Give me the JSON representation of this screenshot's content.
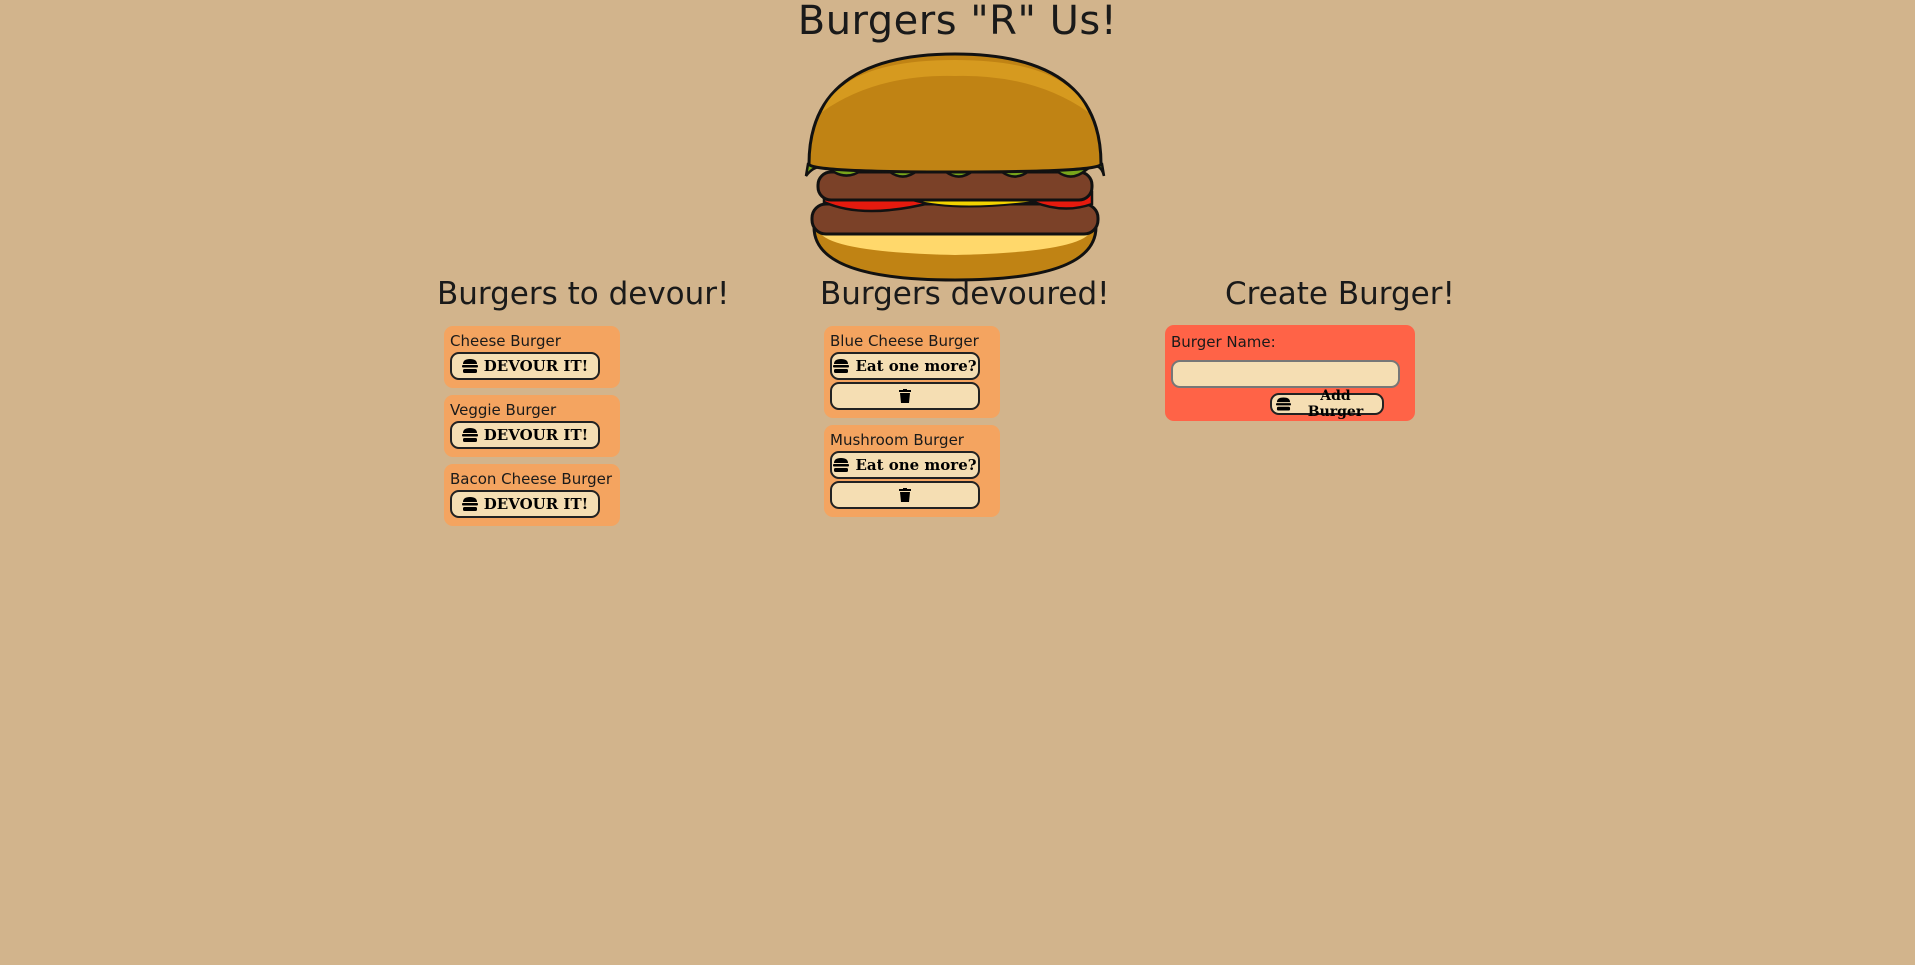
{
  "header": {
    "title": "Burgers \"R\" Us!"
  },
  "columns": {
    "to_devour": {
      "heading": "Burgers to devour!"
    },
    "devoured": {
      "heading": "Burgers devoured!"
    },
    "create": {
      "heading": "Create Burger!"
    }
  },
  "to_devour": [
    {
      "name": "Cheese Burger",
      "button": "DEVOUR IT!"
    },
    {
      "name": "Veggie Burger",
      "button": "DEVOUR IT!"
    },
    {
      "name": "Bacon Cheese Burger",
      "button": "DEVOUR IT!"
    }
  ],
  "devoured": [
    {
      "name": "Blue Cheese Burger",
      "button": "Eat one more?"
    },
    {
      "name": "Mushroom Burger",
      "button": "Eat one more?"
    }
  ],
  "create_form": {
    "label": "Burger Name:",
    "input_value": "",
    "input_placeholder": "",
    "submit_label": "Add Burger"
  },
  "icons": {
    "burger": "hamburger-icon",
    "trash": "trash-icon"
  },
  "colors": {
    "background": "#d2b48c",
    "card": "#f4a460",
    "create_panel": "#ff6347",
    "button": "#f5deb3"
  }
}
